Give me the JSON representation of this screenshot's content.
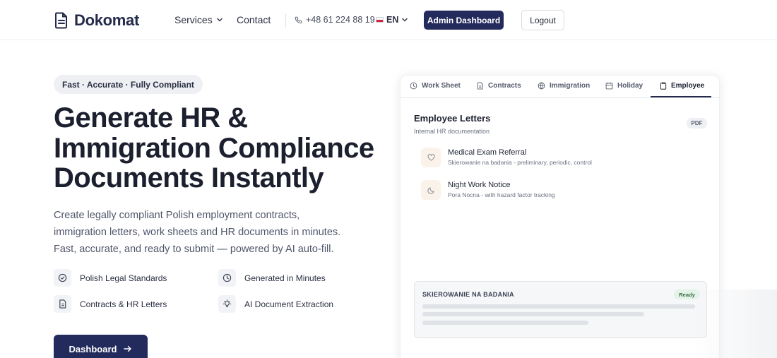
{
  "nav": {
    "logo_text": "Dokomat",
    "services_label": "Services",
    "contact_label": "Contact",
    "phone": "+48 61 224 88 19",
    "language": "EN",
    "admin_button": "Admin Dashboard",
    "logout_button": "Logout"
  },
  "hero": {
    "badge": "Fast · Accurate · Fully Compliant",
    "title_line1": "Generate HR &",
    "title_line2": "Immigration Compliance",
    "title_line3": "Documents Instantly",
    "subtitle": "Create legally compliant Polish employment contracts, immigration letters, work sheets and HR documents in minutes. Fast, accurate, and ready to submit — powered by AI auto-fill.",
    "features": [
      {
        "label": "Polish Legal Standards",
        "icon": "check-circle-icon"
      },
      {
        "label": "Generated in Minutes",
        "icon": "clock-icon"
      },
      {
        "label": "Contracts & HR Letters",
        "icon": "document-icon"
      },
      {
        "label": "AI Document Extraction",
        "icon": "lightbulb-icon"
      }
    ],
    "cta_label": "Dashboard"
  },
  "card": {
    "tabs": [
      {
        "label": "Work Sheet",
        "icon": "clock-icon"
      },
      {
        "label": "Contracts",
        "icon": "document-icon"
      },
      {
        "label": "Immigration",
        "icon": "globe-icon"
      },
      {
        "label": "Holiday",
        "icon": "calendar-icon"
      },
      {
        "label": "Employee",
        "icon": "clipboard-icon",
        "active": true
      }
    ],
    "title": "Employee Letters",
    "subtitle": "Internal HR documentation",
    "format_badge": "PDF",
    "letters": [
      {
        "name": "Medical Exam Referral",
        "desc": "Skierowanie na badania - preliminary, periodic, control",
        "icon": "heart-icon"
      },
      {
        "name": "Night Work Notice",
        "desc": "Pora Nocna - with hazard factor tracking",
        "icon": "moon-icon"
      }
    ],
    "preview": {
      "title": "SKIEROWANIE NA BADANIA",
      "status": "Ready"
    }
  },
  "colors": {
    "primary": "#232a5c",
    "text": "#1b1f2e",
    "muted": "#50566a",
    "accent_bg": "#fbf3ea",
    "ready_bg": "#e4f3e8"
  }
}
